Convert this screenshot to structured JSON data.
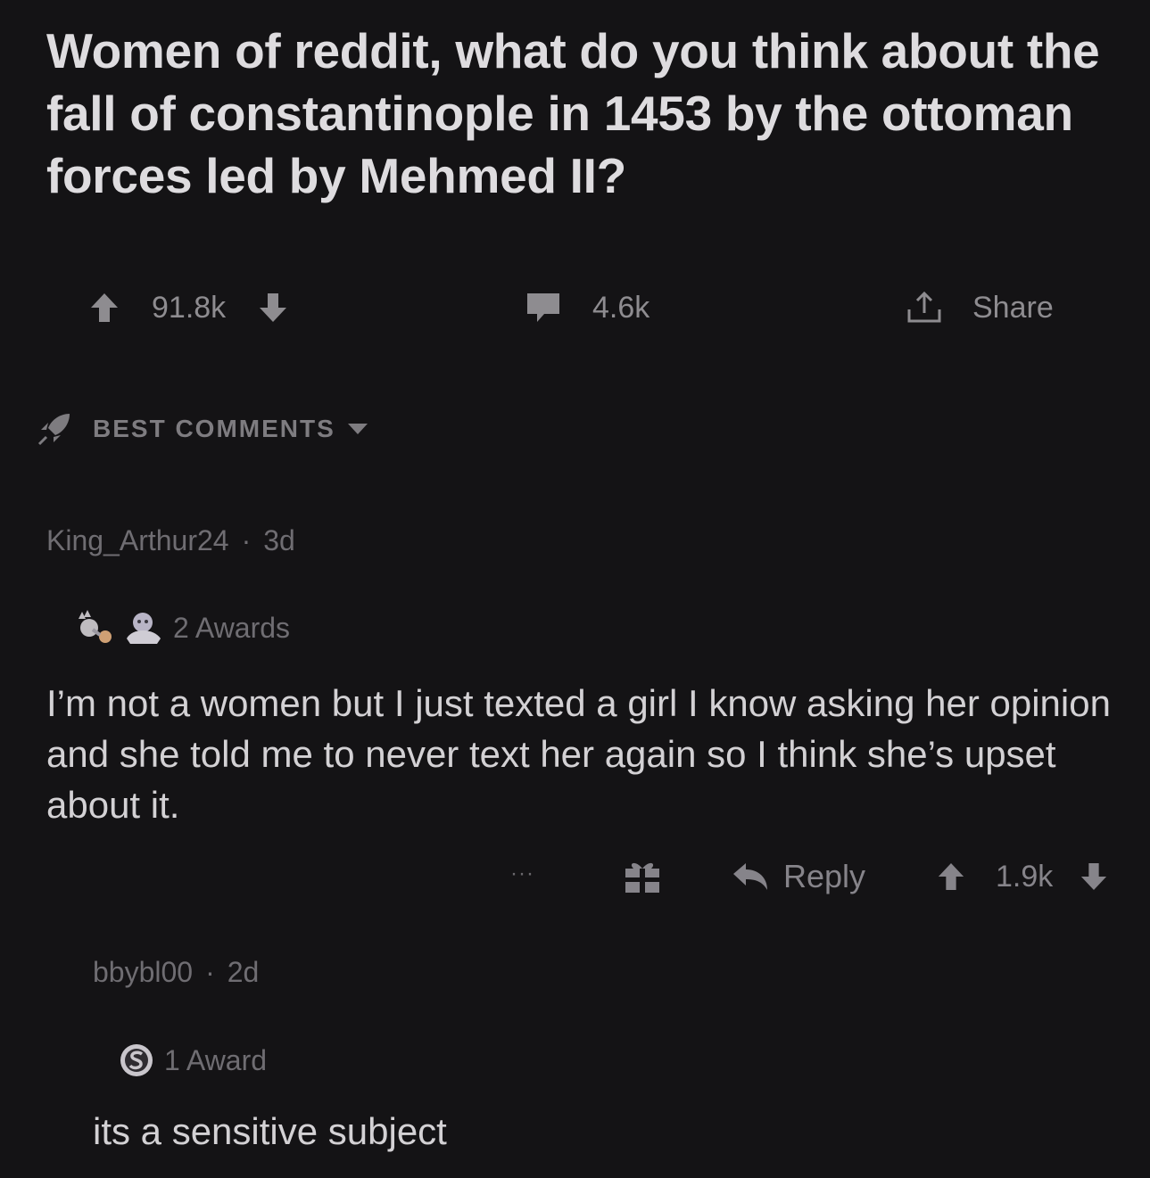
{
  "post": {
    "title": "Women of reddit, what do you think about the fall of constantinople in 1453 by the ottoman forces led by Mehmed II?",
    "upvotes": "91.8k",
    "comments": "4.6k",
    "share_label": "Share"
  },
  "sort": {
    "label": "BEST COMMENTS"
  },
  "comments": [
    {
      "author": "King_Arthur24",
      "separator": "·",
      "age": "3d",
      "awards_label": "2 Awards",
      "body": "I’m not a women but I just texted a girl I know asking her opinion and she told me to never text her again so I think she’s upset about it.",
      "more": "···",
      "reply_label": "Reply",
      "score": "1.9k"
    },
    {
      "author": "bbybl00",
      "separator": "·",
      "age": "2d",
      "awards_label": "1 Award",
      "body": "its a sensitive subject"
    }
  ],
  "icons": {
    "upvote": "arrow-up-icon",
    "downvote": "arrow-down-icon",
    "comments": "speech-bubble-icon",
    "share": "share-icon",
    "sort": "rocket-icon",
    "sort_dropdown": "caret-down-icon",
    "award": "gift-icon",
    "reply": "reply-arrow-icon"
  },
  "colors": {
    "background": "#141315",
    "text_primary": "#dedcdf",
    "text_muted": "#8e8c90"
  }
}
